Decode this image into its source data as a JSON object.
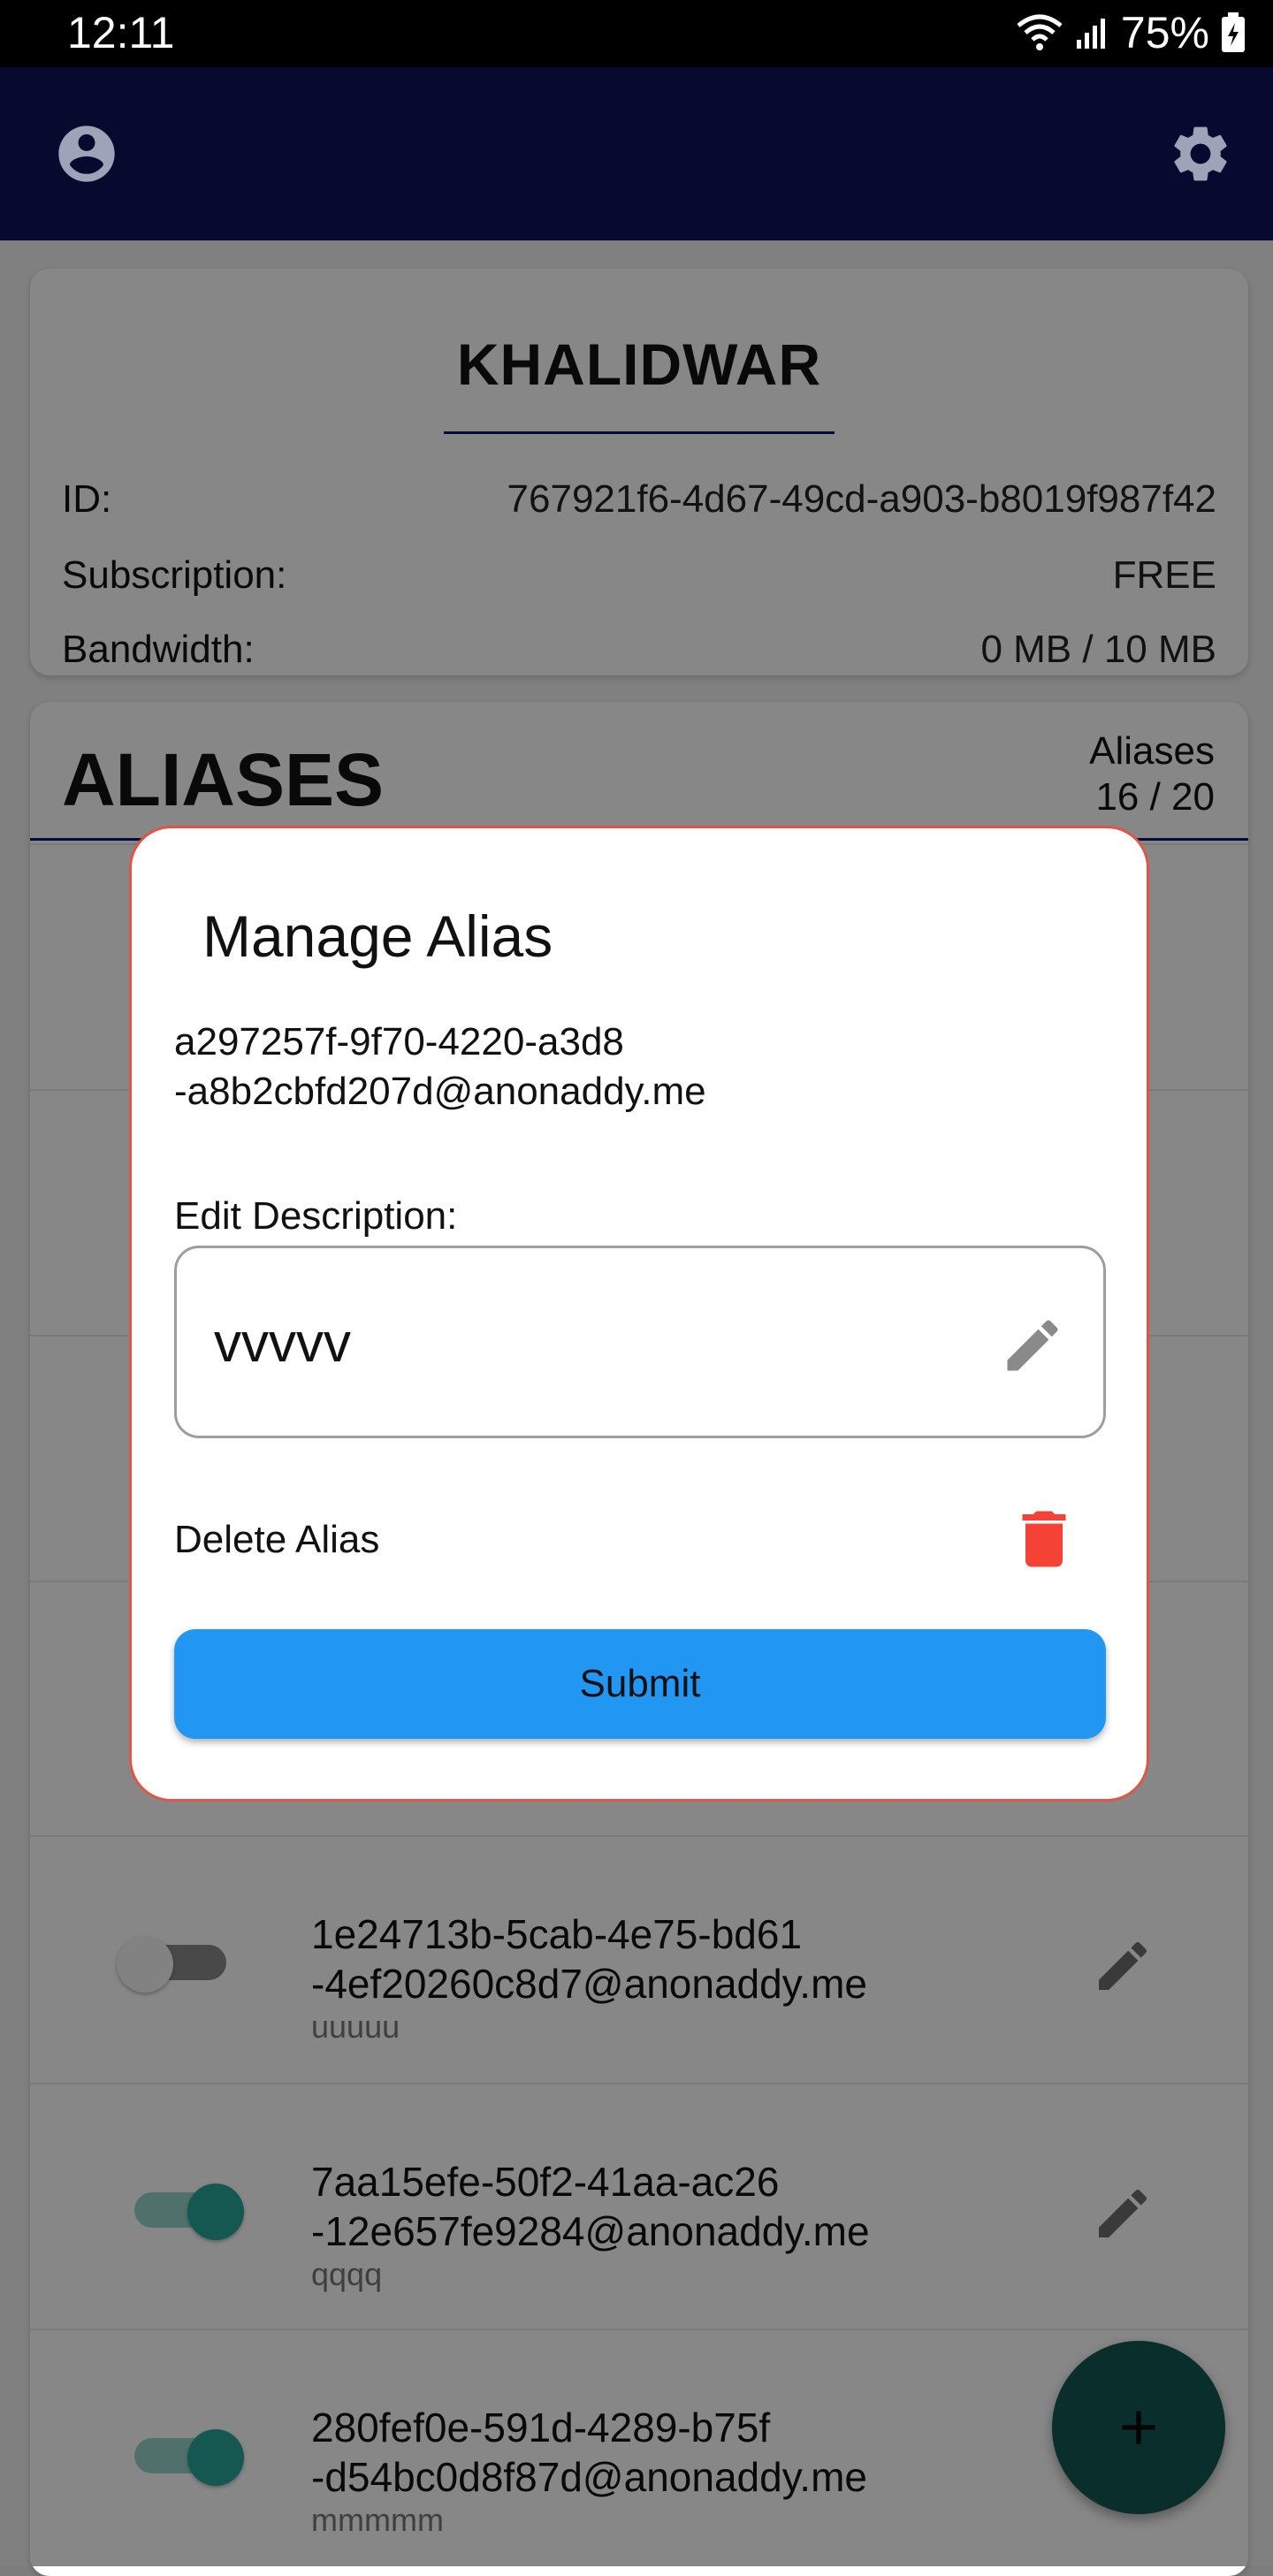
{
  "status_bar": {
    "time": "12:11",
    "battery": "75%",
    "icons": [
      "wifi-icon",
      "signal-icon",
      "battery-charging-icon"
    ]
  },
  "app_bar": {
    "icons": [
      "account-circle-icon",
      "settings-gear-icon"
    ]
  },
  "profile": {
    "username": "KHALIDWAR",
    "id_label": "ID:",
    "id_value": "767921f6-4d67-49cd-a903-b8019f987f42",
    "subscription_label": "Subscription:",
    "subscription_value": "FREE",
    "bandwidth_label": "Bandwidth:",
    "bandwidth_value": "0 MB / 10 MB"
  },
  "aliases": {
    "title": "ALIASES",
    "count_label": "Aliases",
    "count_value": "16 / 20",
    "items": [
      {
        "email_line1": "1e24713b-5cab-4e75-bd61",
        "email_line2": "-4ef20260c8d7@anonaddy.me",
        "description": "uuuuu",
        "active": false
      },
      {
        "email_line1": "7aa15efe-50f2-41aa-ac26",
        "email_line2": "-12e657fe9284@anonaddy.me",
        "description": "qqqq",
        "active": true
      },
      {
        "email_line1": "280fef0e-591d-4289-b75f",
        "email_line2": "-d54bc0d8f87d@anonaddy.me",
        "description": "mmmmm",
        "active": true
      }
    ]
  },
  "dialog": {
    "title": "Manage Alias",
    "alias_line1": "a297257f-9f70-4220-a3d8",
    "alias_line2": "-a8b2cbfd207d@anonaddy.me",
    "edit_label": "Edit Description:",
    "description_value": "vvvvv",
    "delete_label": "Delete Alias",
    "submit_label": "Submit"
  },
  "fab": {
    "icon": "plus-icon"
  },
  "colors": {
    "app_bar": "#070a2e",
    "accent_teal": "#26a69a",
    "submit_blue": "#2196f3",
    "delete_red": "#f44336",
    "dialog_border": "#e05547",
    "divider_navy": "#0b1470"
  }
}
